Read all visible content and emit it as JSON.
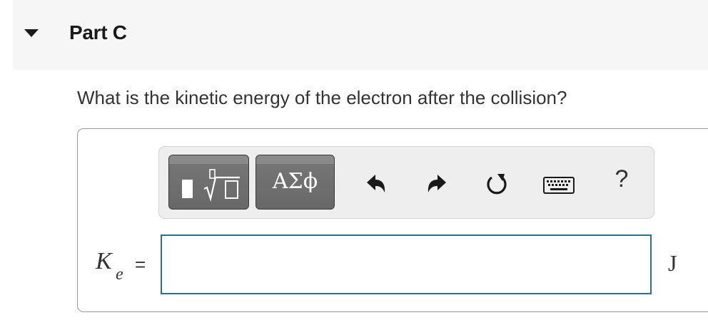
{
  "part": {
    "title": "Part C",
    "collapse_icon": "caret-down-icon"
  },
  "question": {
    "text": "What is the kinetic energy of the electron after the collision?"
  },
  "toolbar": {
    "templates_icon": "templates-icon",
    "symbols_label": "ΑΣϕ",
    "undo_icon": "undo-icon",
    "redo_icon": "redo-icon",
    "reset_icon": "reset-icon",
    "keyboard_icon": "keyboard-icon",
    "help_label": "?"
  },
  "answer": {
    "variable": "K",
    "variable_subscript": "e",
    "equals": "=",
    "value": "",
    "unit": "J"
  },
  "colors": {
    "header_bg": "#f6f6f6",
    "button_bg": "#707070",
    "input_border": "#2f6f87",
    "text": "#333333"
  }
}
